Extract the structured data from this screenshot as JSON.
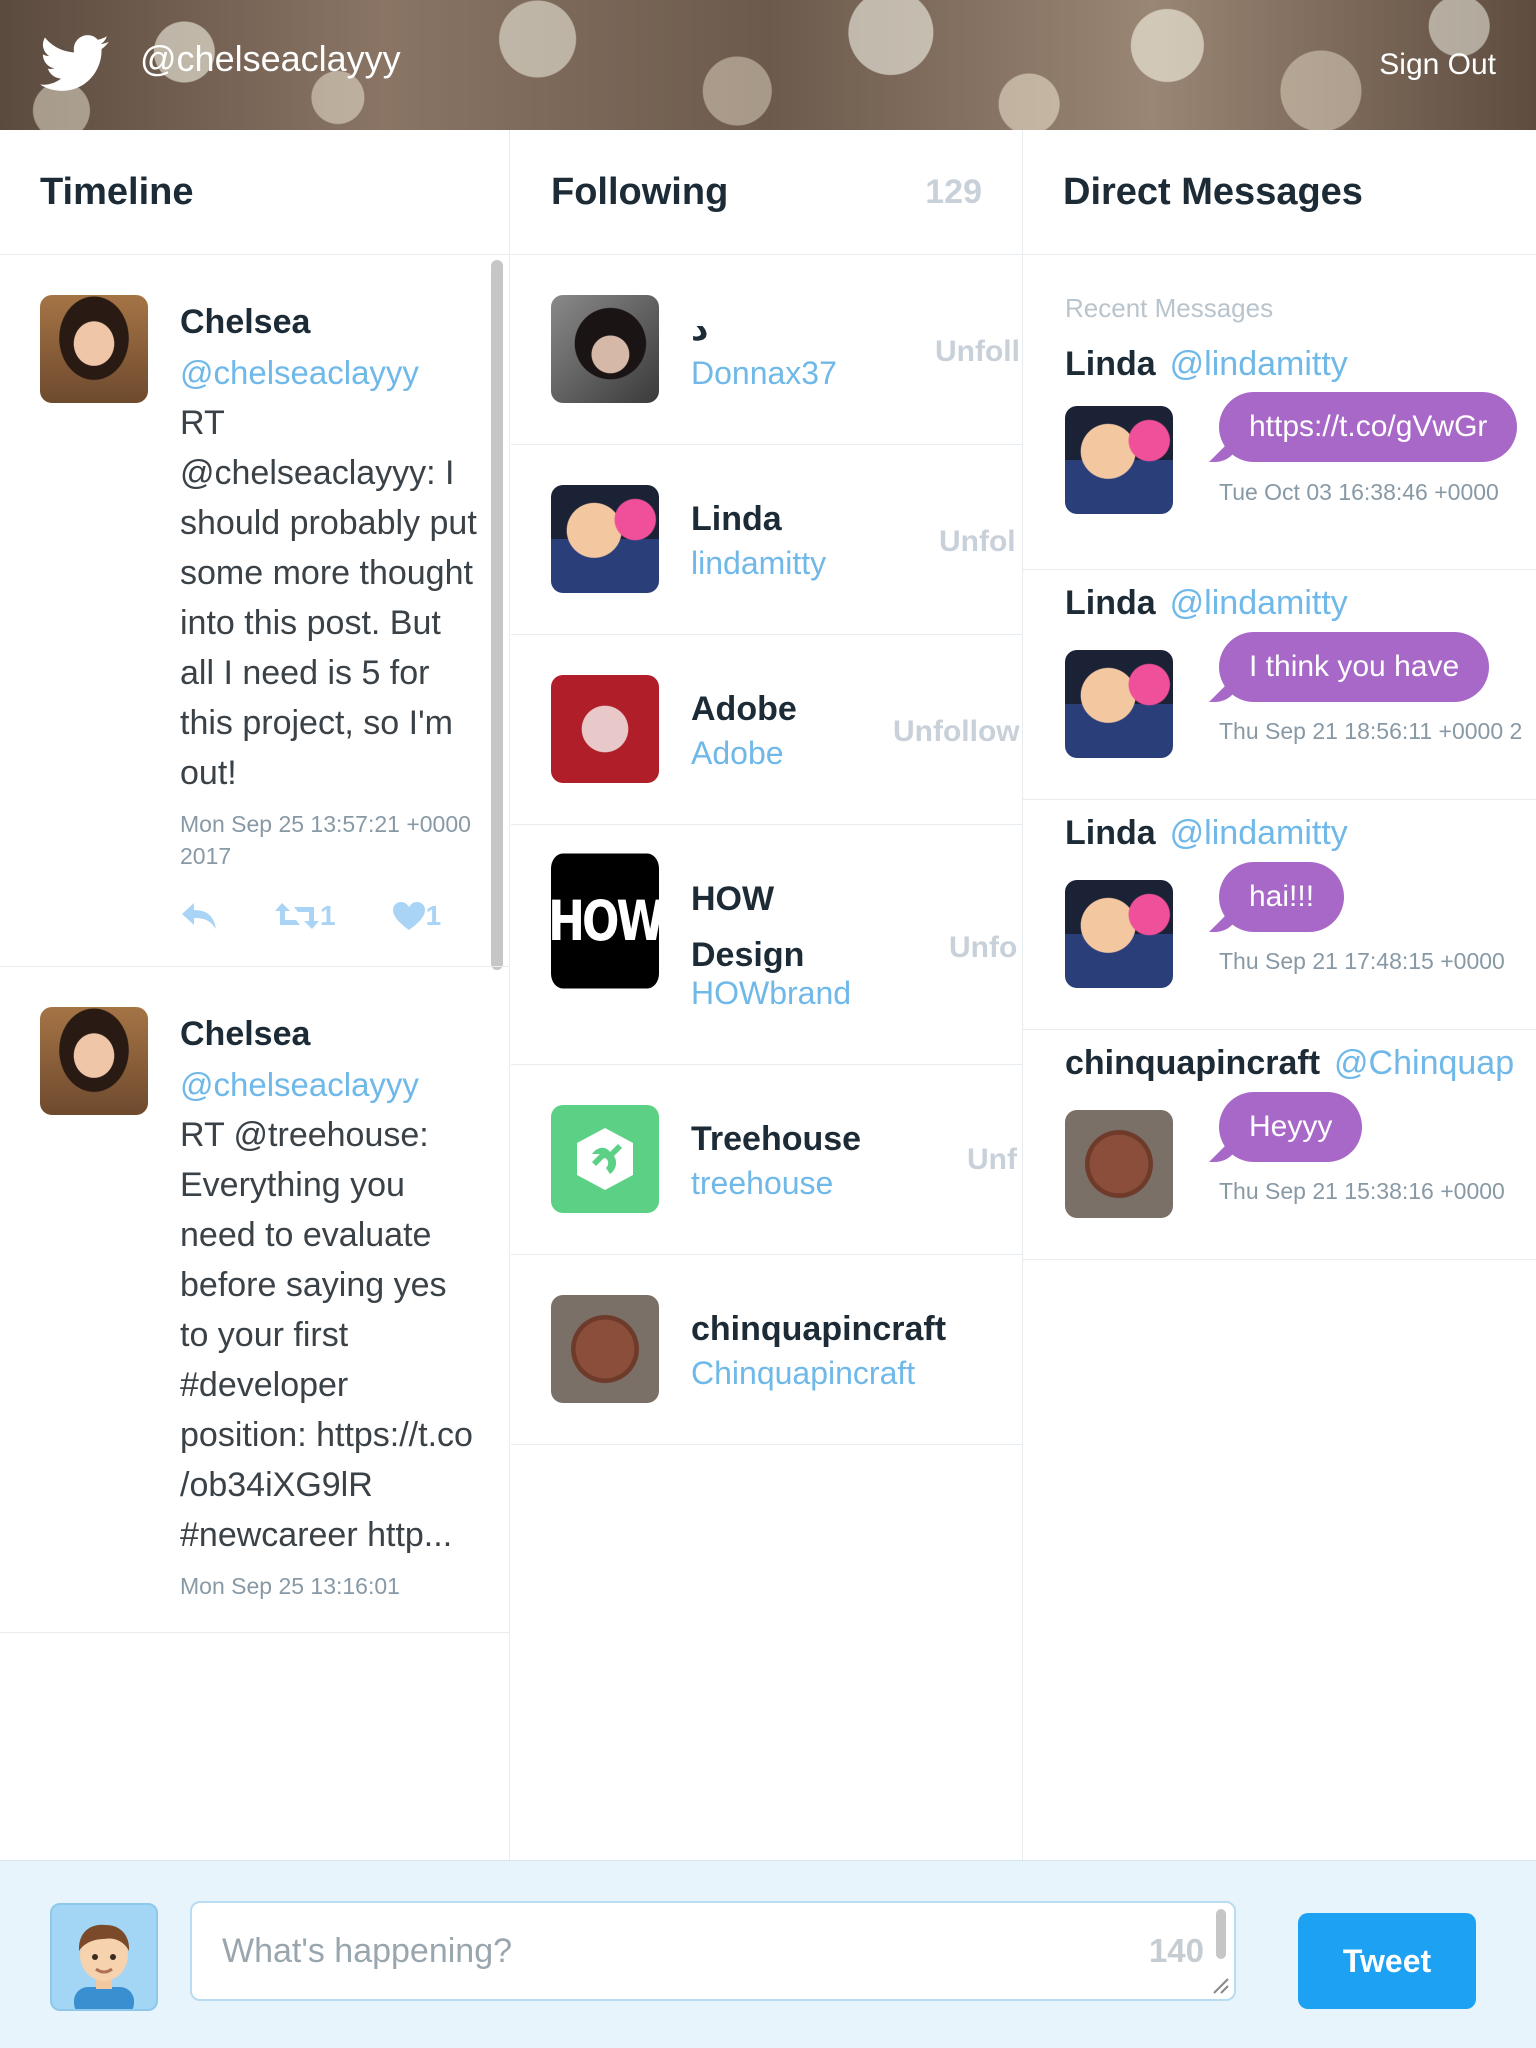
{
  "header": {
    "handle": "@chelseaclayyy",
    "sign_out": "Sign Out"
  },
  "timeline": {
    "title": "Timeline",
    "tweets": [
      {
        "name": "Chelsea",
        "handle": "@chelseaclayyy",
        "text": "RT @chelseaclayyy: I should probably put some more thought into this post. But all I need is 5 for this project, so I'm out!",
        "date": "Mon Sep 25 13:57:21 +0000 2017",
        "retweets": "1",
        "likes": "1"
      },
      {
        "name": "Chelsea",
        "handle": "@chelseaclayyy",
        "text": "RT @treehouse: Everything you need to evaluate before saying yes to your first #developer position: https://t.co /ob34iXG9lR #newcareer http...",
        "date": "Mon Sep 25 13:16:01"
      }
    ]
  },
  "following": {
    "title": "Following",
    "count": "129",
    "people": [
      {
        "name": "د",
        "handle": "Donnax37",
        "action": "Unfoll"
      },
      {
        "name": "Linda",
        "handle": "lindamitty",
        "action": "Unfol"
      },
      {
        "name": "Adobe",
        "handle": "Adobe",
        "action": "Unfollow"
      },
      {
        "name": "HOW Design",
        "handle": "HOWbrand",
        "action": "Unfo",
        "logo_text": "HOW"
      },
      {
        "name": "Treehouse",
        "handle": "treehouse",
        "action": "Unf"
      },
      {
        "name": "chinquapincraft",
        "handle": "Chinquapincraft"
      }
    ]
  },
  "dms": {
    "title": "Direct Messages",
    "recent_label": "Recent Messages",
    "messages": [
      {
        "name": "Linda",
        "handle": "@lindamitty",
        "text": "https://t.co/gVwGr",
        "date": "Tue Oct 03 16:38:46 +0000"
      },
      {
        "name": "Linda",
        "handle": "@lindamitty",
        "text": "I think you have",
        "date": "Thu Sep 21 18:56:11 +0000 2"
      },
      {
        "name": "Linda",
        "handle": "@lindamitty",
        "text": "hai!!!",
        "date": "Thu Sep 21 17:48:15 +0000"
      },
      {
        "name": "chinquapincraft",
        "handle": "@Chinquap",
        "text": "Heyyy",
        "date": "Thu Sep 21 15:38:16 +0000"
      }
    ]
  },
  "composer": {
    "placeholder": "What's happening?",
    "char_count": "140",
    "tweet_button": "Tweet"
  },
  "colors": {
    "accent": "#1da1f2",
    "link": "#6fb8e8",
    "dm_bubble": "#a868c8",
    "composer_bg": "#e8f4fc"
  },
  "icons": [
    "twitter-bird-icon",
    "reply-icon",
    "retweet-icon",
    "heart-icon",
    "resize-handle-icon"
  ]
}
